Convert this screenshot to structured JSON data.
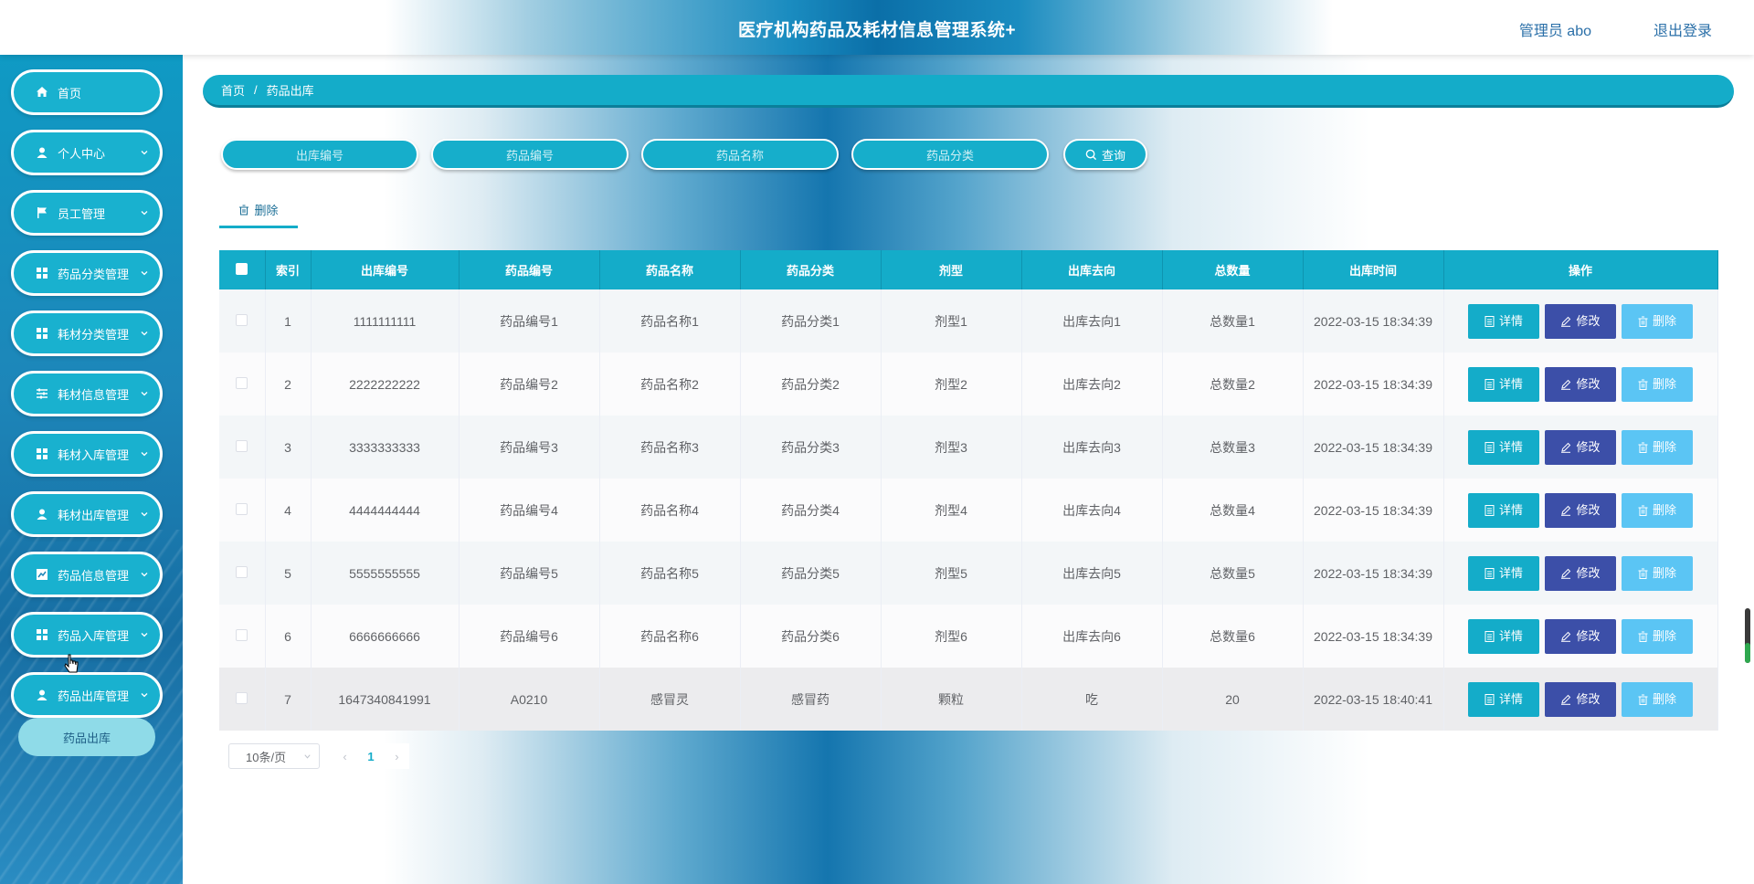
{
  "header": {
    "title": "医疗机构药品及耗材信息管理系统+",
    "user": "管理员 abo",
    "logout": "退出登录"
  },
  "sidebar": {
    "items": [
      {
        "label": "首页",
        "icon": "home-icon"
      },
      {
        "label": "个人中心",
        "icon": "user-icon"
      },
      {
        "label": "员工管理",
        "icon": "flag-icon"
      },
      {
        "label": "药品分类管理",
        "icon": "grid-icon"
      },
      {
        "label": "耗材分类管理",
        "icon": "grid-icon"
      },
      {
        "label": "耗材信息管理",
        "icon": "sliders-icon"
      },
      {
        "label": "耗材入库管理",
        "icon": "grid-icon"
      },
      {
        "label": "耗材出库管理",
        "icon": "user-icon"
      },
      {
        "label": "药品信息管理",
        "icon": "chart-icon"
      },
      {
        "label": "药品入库管理",
        "icon": "grid-icon"
      },
      {
        "label": "药品出库管理",
        "icon": "user-icon"
      }
    ],
    "submenu": "药品出库"
  },
  "breadcrumb": {
    "home": "首页",
    "sep": "/",
    "current": "药品出库"
  },
  "search": {
    "placeholders": [
      "出库编号",
      "药品编号",
      "药品名称",
      "药品分类"
    ],
    "button": "查询"
  },
  "toolbar": {
    "delete": "删除"
  },
  "table": {
    "headers": [
      "索引",
      "出库编号",
      "药品编号",
      "药品名称",
      "药品分类",
      "剂型",
      "出库去向",
      "总数量",
      "出库时间",
      "操作"
    ],
    "rows": [
      [
        "1",
        "1111111111",
        "药品编号1",
        "药品名称1",
        "药品分类1",
        "剂型1",
        "出库去向1",
        "总数量1",
        "2022-03-15 18:34:39"
      ],
      [
        "2",
        "2222222222",
        "药品编号2",
        "药品名称2",
        "药品分类2",
        "剂型2",
        "出库去向2",
        "总数量2",
        "2022-03-15 18:34:39"
      ],
      [
        "3",
        "3333333333",
        "药品编号3",
        "药品名称3",
        "药品分类3",
        "剂型3",
        "出库去向3",
        "总数量3",
        "2022-03-15 18:34:39"
      ],
      [
        "4",
        "4444444444",
        "药品编号4",
        "药品名称4",
        "药品分类4",
        "剂型4",
        "出库去向4",
        "总数量4",
        "2022-03-15 18:34:39"
      ],
      [
        "5",
        "5555555555",
        "药品编号5",
        "药品名称5",
        "药品分类5",
        "剂型5",
        "出库去向5",
        "总数量5",
        "2022-03-15 18:34:39"
      ],
      [
        "6",
        "6666666666",
        "药品编号6",
        "药品名称6",
        "药品分类6",
        "剂型6",
        "出库去向6",
        "总数量6",
        "2022-03-15 18:34:39"
      ],
      [
        "7",
        "1647340841991",
        "A0210",
        "感冒灵",
        "感冒药",
        "颗粒",
        "吃",
        "20",
        "2022-03-15 18:40:41"
      ]
    ],
    "actions": {
      "detail": "详情",
      "edit": "修改",
      "delete": "删除"
    }
  },
  "pagination": {
    "page_size": "10条/页",
    "current_page": "1"
  },
  "colors": {
    "accent": "#14acc9",
    "edit": "#3c4fa8",
    "delete": "#5bc5f4",
    "link": "#2a6fa8"
  }
}
